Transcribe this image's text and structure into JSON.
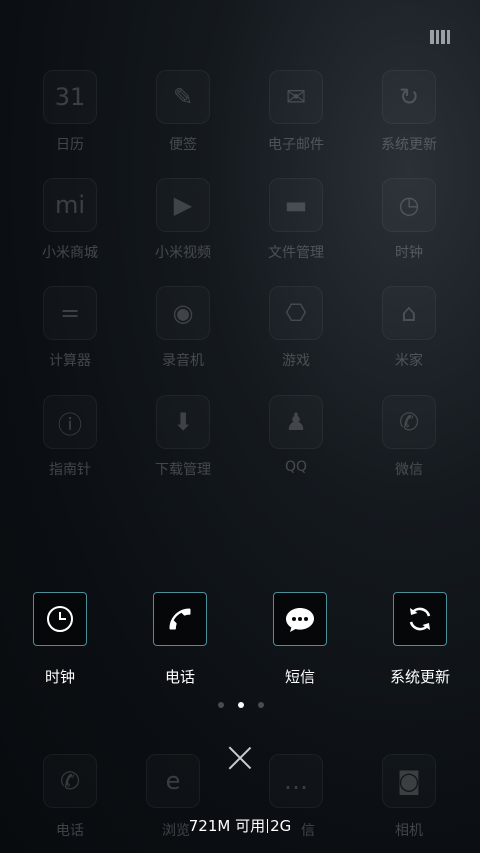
{
  "status": {
    "icon": "sim-signal-icon"
  },
  "background_apps": [
    {
      "label": "日历",
      "icon": "calendar-icon",
      "glyph": "31"
    },
    {
      "label": "便签",
      "icon": "notes-icon",
      "glyph": "✎"
    },
    {
      "label": "电子邮件",
      "icon": "email-icon",
      "glyph": "✉"
    },
    {
      "label": "系统更新",
      "icon": "update-icon",
      "glyph": "↻"
    },
    {
      "label": "小米商城",
      "icon": "mi-store-icon",
      "glyph": "mi"
    },
    {
      "label": "小米视频",
      "icon": "video-icon",
      "glyph": "▶"
    },
    {
      "label": "文件管理",
      "icon": "folder-icon",
      "glyph": "▬"
    },
    {
      "label": "时钟",
      "icon": "clock-icon",
      "glyph": "◷"
    },
    {
      "label": "计算器",
      "icon": "calculator-icon",
      "glyph": "="
    },
    {
      "label": "录音机",
      "icon": "recorder-icon",
      "glyph": "◉"
    },
    {
      "label": "游戏",
      "icon": "gamepad-icon",
      "glyph": "⎔"
    },
    {
      "label": "米家",
      "icon": "mihome-icon",
      "glyph": "⌂"
    },
    {
      "label": "指南针",
      "icon": "compass-icon",
      "glyph": "ⓘ"
    },
    {
      "label": "下载管理",
      "icon": "download-icon",
      "glyph": "⬇"
    },
    {
      "label": "QQ",
      "icon": "qq-icon",
      "glyph": "♟"
    },
    {
      "label": "微信",
      "icon": "wechat-icon",
      "glyph": "✆"
    }
  ],
  "dock_apps": [
    {
      "label": "电话",
      "icon": "phone-icon"
    },
    {
      "label": "浏览",
      "icon": "browser-icon"
    },
    {
      "label": "信",
      "icon": "message-icon"
    },
    {
      "label": "相机",
      "icon": "camera-icon"
    }
  ],
  "selected_apps": [
    {
      "label": "时钟",
      "icon": "clock-icon"
    },
    {
      "label": "电话",
      "icon": "phone-icon"
    },
    {
      "label": "短信",
      "icon": "message-icon"
    },
    {
      "label": "系统更新",
      "icon": "update-icon"
    }
  ],
  "pager": {
    "count": 3,
    "active": 1
  },
  "memory": {
    "free": "721M 可用",
    "total": "2G"
  },
  "colors": {
    "accent_border": "#4a8f9a",
    "background": "#0b0f13"
  }
}
